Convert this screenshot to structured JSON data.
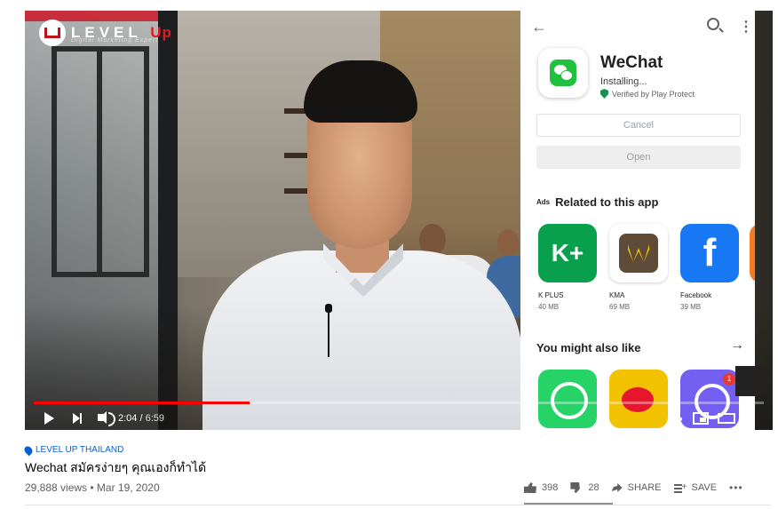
{
  "logo": {
    "brand": "LEVEL",
    "brand_accent": "Up",
    "tagline": "Digital Marketing Expert"
  },
  "store": {
    "app_name": "WeChat",
    "status": "Installing...",
    "verified": "Verified by Play Protect",
    "cancel_label": "Cancel",
    "open_label": "Open",
    "ads_tag": "Ads",
    "related_title": "Related to this app",
    "related_apps": [
      {
        "name": "K PLUS",
        "size": "40 MB",
        "icon_text": "K+"
      },
      {
        "name": "KMA",
        "size": "69 MB"
      },
      {
        "name": "Facebook",
        "size": "39 MB",
        "icon_text": "f"
      }
    ],
    "also_like_title": "You might also like",
    "viber_badge": "1"
  },
  "player": {
    "current_time": "2:04",
    "duration": "6:59",
    "progress_percent": 29.6
  },
  "video": {
    "channel": "LEVEL UP THAILAND",
    "title": "Wechat สมัครง่ายๆ คุณเองก็ทำได้",
    "meta": "29,888 views • Mar 19, 2020",
    "likes": "398",
    "dislikes": "28",
    "share_label": "SHARE",
    "save_label": "SAVE",
    "more_label": "•••"
  },
  "colors": {
    "accent": "#ff0000",
    "link": "#065fd4",
    "wechat_green": "#20c13e"
  }
}
